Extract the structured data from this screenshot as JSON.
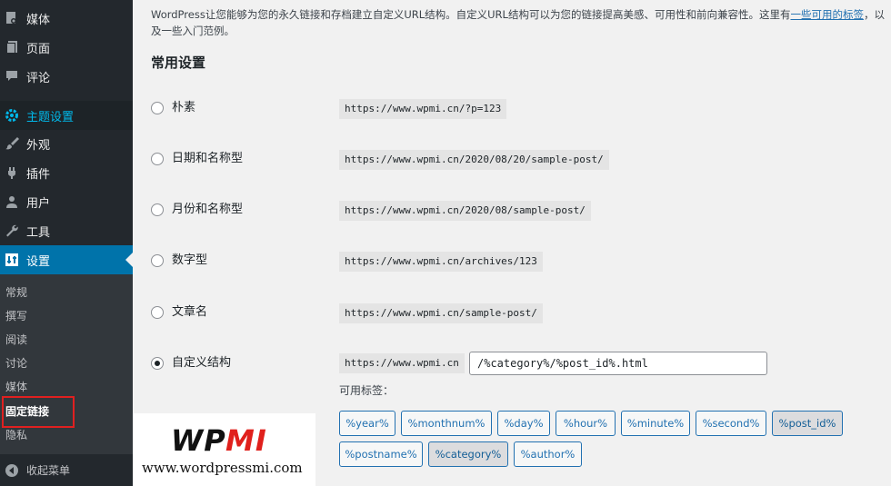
{
  "sidebar": {
    "items": [
      {
        "label": "媒体",
        "icon": "media-icon"
      },
      {
        "label": "页面",
        "icon": "page-icon"
      },
      {
        "label": "评论",
        "icon": "comment-icon"
      },
      {
        "label": "主题设置",
        "icon": "gear-icon"
      },
      {
        "label": "外观",
        "icon": "brush-icon"
      },
      {
        "label": "插件",
        "icon": "plugin-icon"
      },
      {
        "label": "用户",
        "icon": "user-icon"
      },
      {
        "label": "工具",
        "icon": "wrench-icon"
      },
      {
        "label": "设置",
        "icon": "settings-icon"
      }
    ],
    "submenu": [
      "常规",
      "撰写",
      "阅读",
      "讨论",
      "媒体",
      "固定链接",
      "隐私"
    ],
    "collapse_label": "收起菜单"
  },
  "intro": {
    "text": "WordPress让您能够为您的永久链接和存档建立自定义URL结构。自定义URL结构可以为您的链接提高美感、可用性和前向兼容性。这里有",
    "link": "一些可用的标签",
    "text_after": "，以及一些入门范例。"
  },
  "section_title": "常用设置",
  "options": [
    {
      "label": "朴素",
      "url": "https://www.wpmi.cn/?p=123"
    },
    {
      "label": "日期和名称型",
      "url": "https://www.wpmi.cn/2020/08/20/sample-post/"
    },
    {
      "label": "月份和名称型",
      "url": "https://www.wpmi.cn/2020/08/sample-post/"
    },
    {
      "label": "数字型",
      "url": "https://www.wpmi.cn/archives/123"
    },
    {
      "label": "文章名",
      "url": "https://www.wpmi.cn/sample-post/"
    },
    {
      "label": "自定义结构",
      "url": "https://www.wpmi.cn"
    }
  ],
  "selected_option": "自定义结构",
  "custom_structure_value": "/%category%/%post_id%.html",
  "tags_label": "可用标签：",
  "tags": [
    "%year%",
    "%monthnum%",
    "%day%",
    "%hour%",
    "%minute%",
    "%second%",
    "%post_id%",
    "%postname%",
    "%category%",
    "%author%"
  ],
  "pressed_tags": [
    "%post_id%",
    "%category%"
  ],
  "watermark": {
    "logo_text": "WPMI",
    "url": "www.wordpressmi.com"
  },
  "colors": {
    "sidebar_bg": "#23282d",
    "active_bg": "#0073aa",
    "accent": "#2271b1",
    "highlight_border": "#e02020",
    "logo_red": "#e0201c"
  }
}
